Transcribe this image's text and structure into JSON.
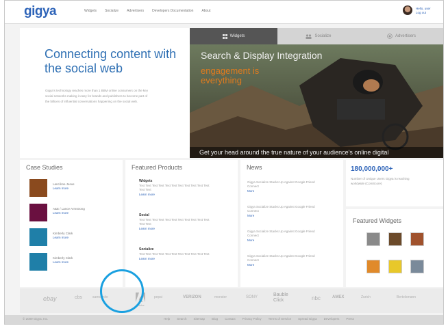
{
  "header": {
    "logo": "gigya",
    "nav": [
      "Widgets",
      "Socialize",
      "Advertisers",
      "Developers Documentation",
      "About"
    ],
    "user_links": [
      "Hello, user",
      "Log out"
    ]
  },
  "hero": {
    "title": "Connecting content with the social web",
    "description": "Gigya's technology reaches more than 1 BBM online consumers on the key social networks making it easy for brands and publishers to become part of the billions of influential conversations happening on the social web.",
    "tabs": [
      {
        "label": "Widgets",
        "icon": "grid-icon"
      },
      {
        "label": "Socialize",
        "icon": "people-icon"
      },
      {
        "label": "Advertisers",
        "icon": "target-icon"
      }
    ],
    "headline": "Search & Display Integration",
    "tagline": "engagement is everything",
    "caption": "Get your head around the true nature of your audience's online digital"
  },
  "case_studies": {
    "title": "Case Studies",
    "items": [
      {
        "name": "Lancôme Jesus",
        "link": "Learn more",
        "color": "#8a4a1e"
      },
      {
        "name": "A&E / Lance Armstrong",
        "link": "Learn more",
        "color": "#6a1040"
      },
      {
        "name": "Kimberly Clark",
        "link": "Learn more",
        "color": "#1f7fa8"
      },
      {
        "name": "Kimberly Clark",
        "link": "Learn more",
        "color": "#1f7fa8"
      }
    ]
  },
  "featured_products": {
    "title": "Featured Products",
    "items": [
      {
        "name": "Widgets",
        "desc": "Text Text Text Text Text Text Text Text Text Text Text Text Text",
        "link": "Learn more"
      },
      {
        "name": "Social",
        "desc": "Text Text Text Text Text Text Text Text Text Text Text Text Text",
        "link": "Learn more"
      },
      {
        "name": "Socialize",
        "desc": "Text Text Text Text Text Text Text Text Text Text Text",
        "link": "Learn more"
      }
    ]
  },
  "news": {
    "title": "News",
    "items": [
      {
        "text": "Gigya Socialize Stacks Up Against Google Friend Connect",
        "link": "More"
      },
      {
        "text": "Gigya Socialize Stacks Up Against Google Friend Connect",
        "link": "More"
      },
      {
        "text": "Gigya Socialize Stacks Up Against Google Friend Connect",
        "link": "More"
      },
      {
        "text": "Gigya Socialize Stacks Up Against Google Friend Connect",
        "link": "More"
      }
    ]
  },
  "stats": {
    "number": "180,000,000+",
    "text": "Number of Unique Users Gigya is reaching worldwide (ComScore)"
  },
  "featured_widgets": {
    "title": "Featured Widgets",
    "items": [
      {
        "icon": "widget-photo-icon",
        "color": "#8a8a8a"
      },
      {
        "icon": "widget-face-icon",
        "color": "#6b4a2a"
      },
      {
        "icon": "widget-portrait-icon",
        "color": "#a0522d"
      },
      {
        "icon": "widget-sunset-icon",
        "color": "#e08a2a"
      },
      {
        "icon": "widget-star-icon",
        "color": "#e8c82a"
      },
      {
        "icon": "widget-people-icon",
        "color": "#7a8a9a"
      }
    ]
  },
  "partners": {
    "items": [
      "ebay",
      "cbs",
      "samsonite",
      "adobe",
      "pepsi",
      "VERIZON",
      "monster",
      "SONY",
      "Bauble Click",
      "nbc",
      "AMEX",
      "Zurich",
      "Bertelsmann"
    ],
    "adobe_label": "Adobe"
  },
  "footer": {
    "copyright": "© 2009 Gigya, Inc.",
    "links": [
      "Help",
      "Search",
      "Sitemap",
      "Blog",
      "Contact",
      "Privacy Policy",
      "Terms of Service",
      "Spread Gigya",
      "Developers",
      "Press"
    ]
  },
  "colors": {
    "brand": "#2d63b8",
    "accent": "#e07b1e",
    "highlight": "#1aa0e0"
  }
}
